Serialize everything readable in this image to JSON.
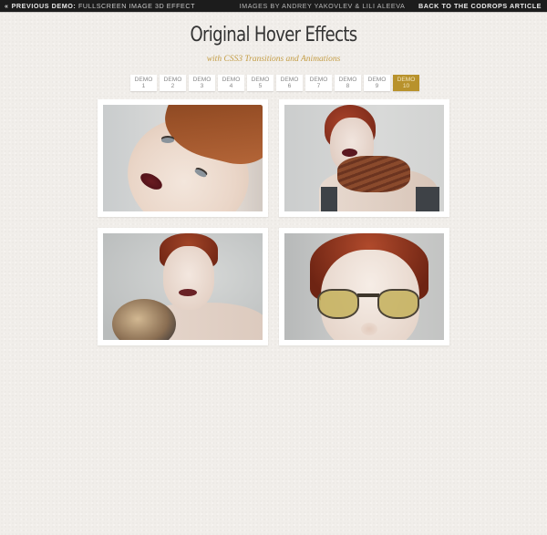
{
  "topbar": {
    "prev_arrow": "«",
    "prev_label": "Previous Demo:",
    "prev_title": "Fullscreen Image 3D Effect",
    "credits": "Images by Andrey Yakovlev & Lili Aleeva",
    "back_link": "Back to the Codrops Article"
  },
  "header": {
    "title": "Original Hover Effects",
    "subtitle": "with CSS3 Transitions and Animations"
  },
  "demo_nav": {
    "active_index": 10,
    "active_color": "#b8922c",
    "items": [
      {
        "label": "DEMO",
        "number": "1"
      },
      {
        "label": "DEMO",
        "number": "2"
      },
      {
        "label": "DEMO",
        "number": "3"
      },
      {
        "label": "DEMO",
        "number": "4"
      },
      {
        "label": "DEMO",
        "number": "5"
      },
      {
        "label": "DEMO",
        "number": "6"
      },
      {
        "label": "DEMO",
        "number": "7"
      },
      {
        "label": "DEMO",
        "number": "8"
      },
      {
        "label": "DEMO",
        "number": "9"
      },
      {
        "label": "DEMO",
        "number": "10"
      }
    ]
  },
  "gallery": {
    "items": [
      {
        "subject": "portrait with brown leather cap"
      },
      {
        "subject": "red-haired woman with knitted rope scarf"
      },
      {
        "subject": "red-haired woman holding fur"
      },
      {
        "subject": "red-haired woman with yellow-tinted glasses"
      }
    ]
  }
}
